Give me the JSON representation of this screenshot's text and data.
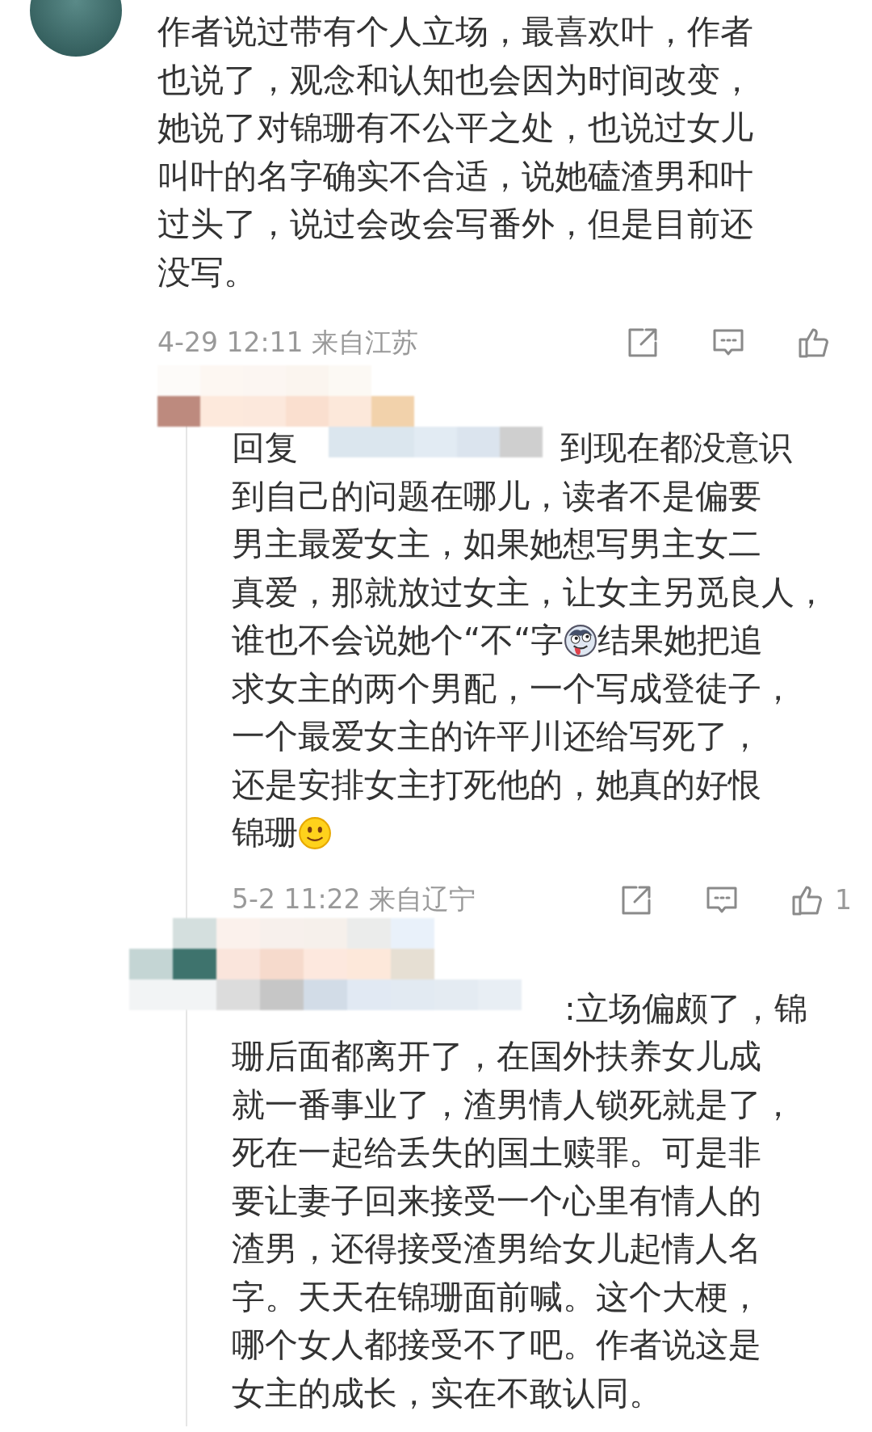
{
  "comment": {
    "lines": [
      {
        "kind": "plain",
        "text": "作者说过带有个人立场，最喜欢叶，作者"
      },
      {
        "kind": "plain",
        "text": "也说了，观念和认知也会因为时间改变，"
      },
      {
        "kind": "plain",
        "text": "她说了对锦珊有不公平之处，也说过女儿"
      },
      {
        "kind": "plain",
        "text": "叫叶的名字确实不合适，说她磕渣男和叶"
      },
      {
        "kind": "plain",
        "text": "过头了，说过会改会写番外，但是目前还"
      },
      {
        "kind": "plain",
        "text": "没写。"
      }
    ],
    "meta": "4-29 12:11 来自江苏"
  },
  "replies": [
    {
      "lead": "回复",
      "lines": [
        {
          "kind": "plain",
          "text": "到现在都没意识"
        },
        {
          "kind": "plain",
          "text": "到自己的问题在哪儿，读者不是偏要"
        },
        {
          "kind": "plain",
          "text": "男主最爱女主，如果她想写男主女二"
        },
        {
          "kind": "plain",
          "text": "真爱，那就放过女主，让女主另觅良人，"
        },
        {
          "kind": "dog",
          "text": "谁也不会说她个“不“字",
          "after": "结果她把追"
        },
        {
          "kind": "plain",
          "text": "求女主的两个男配，一个写成登徒子，"
        },
        {
          "kind": "plain",
          "text": "一个最爱女主的许平川还给写死了，"
        },
        {
          "kind": "plain",
          "text": "还是安排女主打死他的，她真的好恨"
        },
        {
          "kind": "smile",
          "text": "锦珊"
        }
      ],
      "meta": "5-2 11:22 来自辽宁",
      "likes": "1"
    },
    {
      "lines": [
        {
          "kind": "plain",
          "text": ":立场偏颇了，锦"
        },
        {
          "kind": "plain",
          "text": "珊后面都离开了，在国外扶养女儿成"
        },
        {
          "kind": "plain",
          "text": "就一番事业了，渣男情人锁死就是了，"
        },
        {
          "kind": "plain",
          "text": "死在一起给丢失的国土赎罪。可是非"
        },
        {
          "kind": "plain",
          "text": "要让妻子回来接受一个心里有情人的"
        },
        {
          "kind": "plain",
          "text": "渣男，还得接受渣男给女儿起情人名"
        },
        {
          "kind": "plain",
          "text": "字。天天在锦珊面前喊。这个大梗，"
        },
        {
          "kind": "plain",
          "text": "哪个女人都接受不了吧。作者说这是"
        },
        {
          "kind": "plain",
          "text": "女主的成长，实在不敢认同。"
        }
      ]
    }
  ]
}
